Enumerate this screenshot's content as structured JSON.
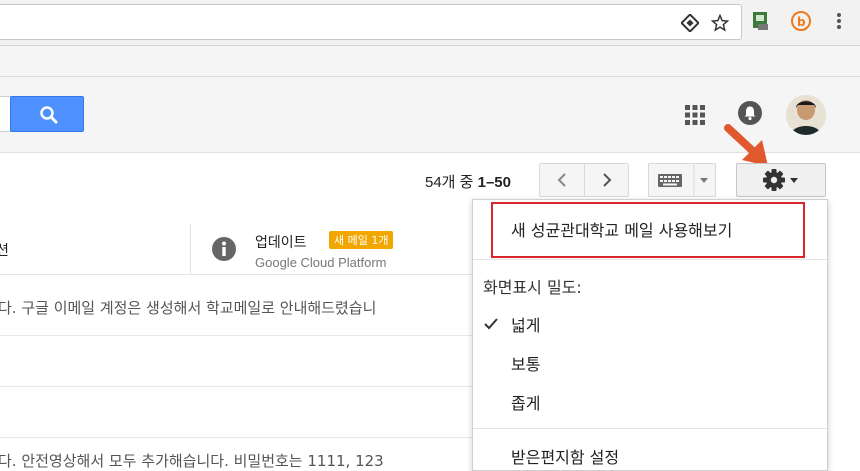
{
  "conversation_count": {
    "prefix": "54개 중 ",
    "range": "1–50"
  },
  "tabs": {
    "social_partial": "션",
    "updates": {
      "label": "업데이트",
      "badge": "새 메일 1개",
      "sender": "Google Cloud Platform"
    }
  },
  "mail_rows": [
    {
      "snippet": "다. 구글 이메일 계정은 생성해서 학교메일로 안내해드렸습니"
    },
    {
      "snippet": ""
    },
    {
      "snippet": ""
    },
    {
      "snippet": "다. 안전영상해서 모두 추가해습니다. 비밀번호는 1111, 123"
    }
  ],
  "settings_menu": {
    "highlighted_item": "새 성균관대학교 메일 사용해보기",
    "density_label": "화면표시 밀도:",
    "density_options": [
      {
        "label": "넓게",
        "checked": true
      },
      {
        "label": "보통",
        "checked": false
      },
      {
        "label": "좁게",
        "checked": false
      }
    ],
    "inbox_settings": "받은편지함 설정"
  },
  "colors": {
    "search_button": "#4d90fe",
    "badge": "#f2a600",
    "annotation_red": "#d9262c",
    "annotation_arrow": "#e0582e"
  },
  "icons": [
    "search-icon",
    "apps-grid-icon",
    "notifications-bell-icon",
    "gear-icon",
    "keyboard-icon",
    "info-icon",
    "check-icon",
    "star-icon",
    "chevron-left-icon",
    "chevron-right-icon"
  ]
}
